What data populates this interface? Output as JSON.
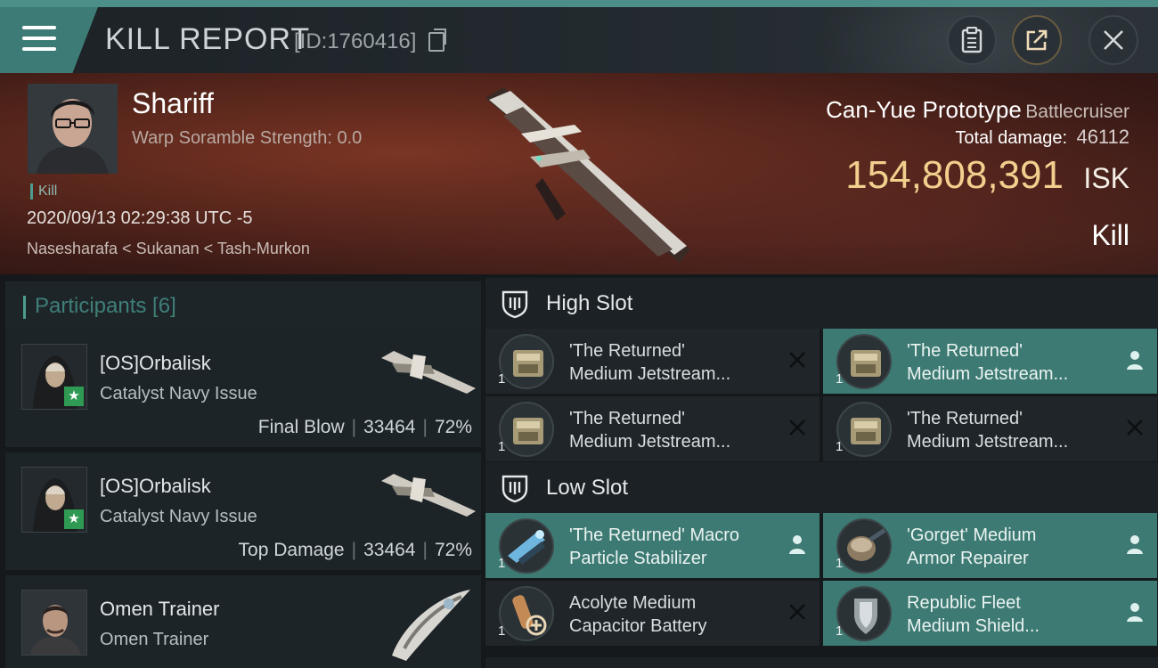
{
  "header": {
    "title": "KILL REPORT",
    "report_id": "[ID:1760416]",
    "icons": [
      "menu-icon",
      "copy-icon",
      "clipboard-icon",
      "share-icon",
      "close-icon"
    ]
  },
  "banner": {
    "pilot_name": "Shariff",
    "warp_scramble": "Warp Soramble Strength: 0.0",
    "kill_tag": "Kill",
    "timestamp": "2020/09/13 02:29:38 UTC -5",
    "location": "Nasesharafa < Sukanan < Tash-Murkon",
    "ship_name": "Can-Yue Prototype",
    "ship_class": "Battlecruiser",
    "damage_label": "Total damage:",
    "damage_value": "46112",
    "isk_value": "154,808,391",
    "isk_unit": "ISK",
    "outcome": "Kill"
  },
  "participants": {
    "label": "Participants [6]",
    "items": [
      {
        "name": "[OS]Orbalisk",
        "ship": "Catalyst Navy Issue",
        "role": "Final Blow",
        "damage": "33464",
        "percent": "72%"
      },
      {
        "name": "[OS]Orbalisk",
        "ship": "Catalyst Navy Issue",
        "role": "Top Damage",
        "damage": "33464",
        "percent": "72%"
      },
      {
        "name": "Omen Trainer",
        "ship": "Omen Trainer"
      }
    ]
  },
  "fitting": {
    "high_slot": {
      "label": "High Slot",
      "modules": [
        {
          "line1": "'The Returned'",
          "line2": "Medium Jetstream...",
          "qty": "1",
          "state": "destroyed"
        },
        {
          "line1": "'The Returned'",
          "line2": "Medium Jetstream...",
          "qty": "1",
          "state": "dropped"
        },
        {
          "line1": "'The Returned'",
          "line2": "Medium Jetstream...",
          "qty": "1",
          "state": "destroyed"
        },
        {
          "line1": "'The Returned'",
          "line2": "Medium Jetstream...",
          "qty": "1",
          "state": "destroyed"
        }
      ]
    },
    "low_slot": {
      "label": "Low Slot",
      "modules": [
        {
          "line1": "'The Returned' Macro",
          "line2": "Particle Stabilizer",
          "qty": "1",
          "state": "dropped"
        },
        {
          "line1": "'Gorget' Medium",
          "line2": "Armor Repairer",
          "qty": "1",
          "state": "dropped"
        },
        {
          "line1": "Acolyte Medium",
          "line2": "Capacitor Battery",
          "qty": "1",
          "state": "destroyed"
        },
        {
          "line1": "Republic Fleet",
          "line2": "Medium Shield...",
          "qty": "1",
          "state": "dropped"
        }
      ]
    }
  },
  "colors": {
    "accent_teal": "#3d7a73",
    "isk_gold": "#f1cf8d",
    "banner_red": "#5a271c"
  }
}
